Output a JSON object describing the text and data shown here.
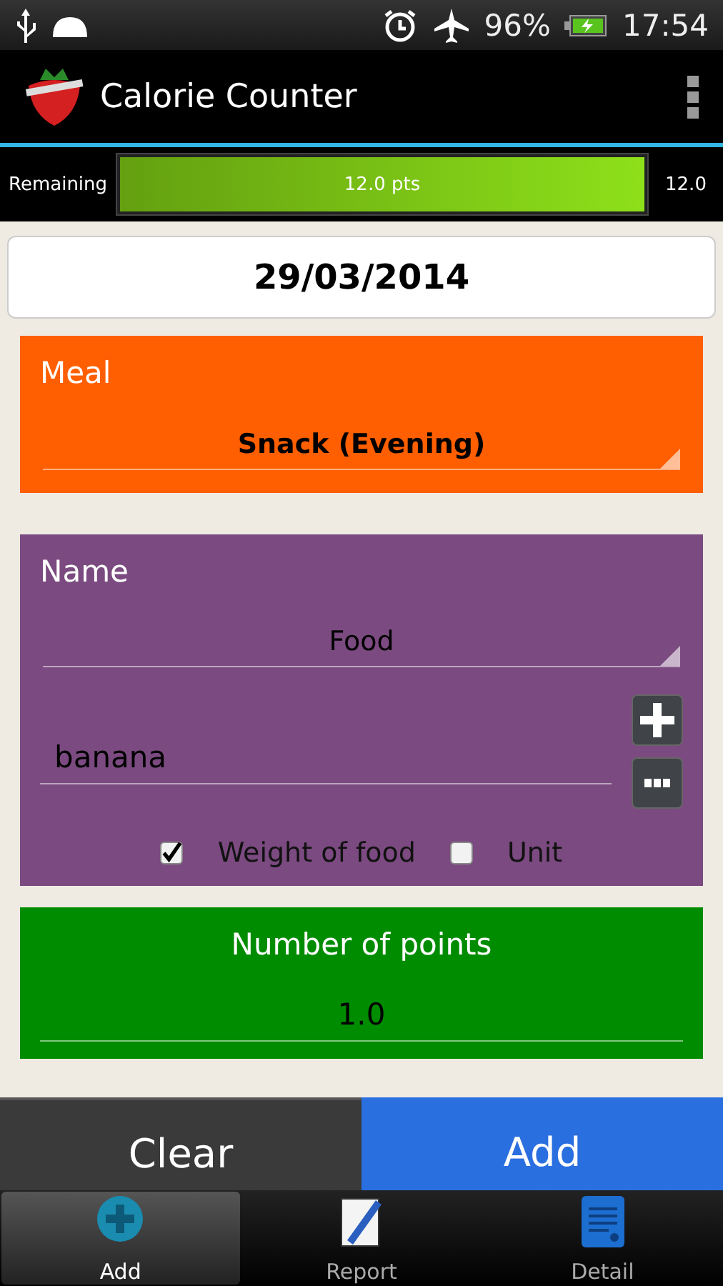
{
  "status_bar": {
    "battery": "96%",
    "time": "17:54"
  },
  "app_bar": {
    "title": "Calorie Counter"
  },
  "remaining": {
    "label": "Remaining",
    "level": 1,
    "reading": "12.0 pts",
    "value": "12.0"
  },
  "date": "29/03/2014",
  "meal": {
    "label": "Meal",
    "value": "Snack (Evening)"
  },
  "name": {
    "label": "Name",
    "category": "Food",
    "value": "banana",
    "options": [
      {
        "label": "Weight of food",
        "checked": true
      },
      {
        "label": "Unit",
        "checked": false
      }
    ]
  },
  "points": {
    "label": "Number of points",
    "value": "1.0"
  },
  "buttons": [
    {
      "label": "Clear",
      "kind": "secondary"
    },
    {
      "label": "Add",
      "kind": "primary"
    }
  ],
  "tabs": [
    {
      "label": "Add",
      "selected": true
    },
    {
      "label": "Report",
      "selected": false
    },
    {
      "label": "Detail",
      "selected": false
    }
  ]
}
